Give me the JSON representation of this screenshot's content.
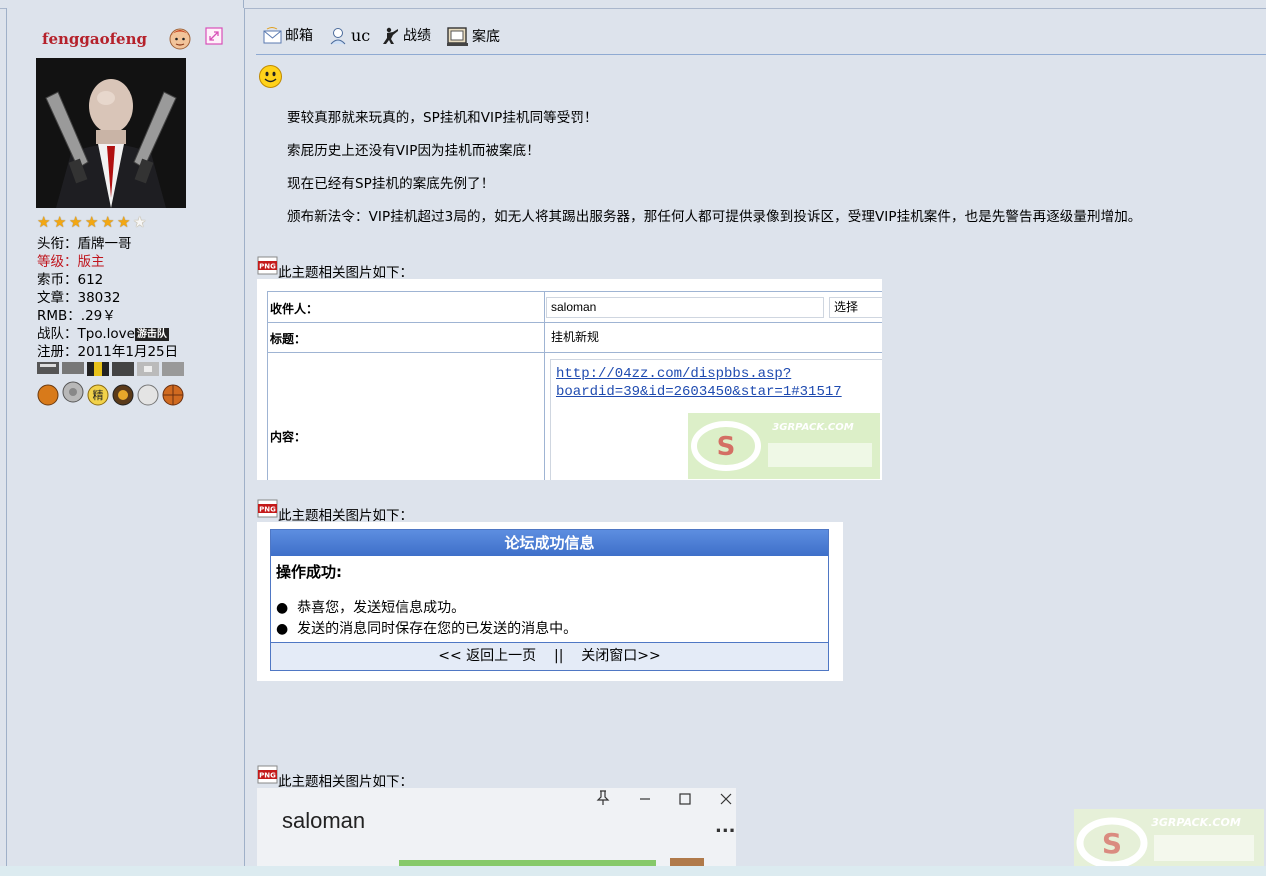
{
  "user": {
    "name": "fenggaofeng",
    "stars_filled": 6,
    "stars_total": 7,
    "title_label": "头衔：",
    "title_value": "盾牌一哥",
    "level_label": "等级：",
    "level_value": "版主",
    "coins_label": "索币：",
    "coins_value": "612",
    "posts_label": "文章：",
    "posts_value": "38032",
    "rmb_label": "RMB：",
    "rmb_value": ".29￥",
    "team_label": "战队：",
    "team_value": "Tpo.love",
    "team_badge": "游击队",
    "reg_label": "注册：",
    "reg_value": "2011年1月25日"
  },
  "toolbar": {
    "mail": "邮箱",
    "uc": "uc",
    "record": "战绩",
    "case": "案底"
  },
  "post": {
    "paragraphs": [
      "要较真那就来玩真的，SP挂机和VIP挂机同等受罚！",
      "索屁历史上还没有VIP因为挂机而被案底！",
      "现在已经有SP挂机的案底先例了！",
      "颁布新法令：VIP挂机超过3局的，如无人将其踢出服务器，那任何人都可提供录像到投诉区，受理VIP挂机案件，也是先警告再逐级量刑增加。"
    ],
    "image_caption": "此主题相关图片如下："
  },
  "image1": {
    "recipient_label": "收件人：",
    "recipient_value": "saloman",
    "select_button": "选择",
    "subject_label": "标题：",
    "subject_value": "挂机新规",
    "content_label": "内容：",
    "link_line1": "http://04zz.com/dispbbs.asp?",
    "link_line2": "boardid=39&id=2603450&star=1#31517",
    "watermark_text": "3GRPACK.COM"
  },
  "image2": {
    "title": "论坛成功信息",
    "heading": "操作成功:",
    "items": [
      "恭喜您，发送短信息成功。",
      "发送的消息同时保存在您的已发送的消息中。"
    ],
    "back": "<< 返回上一页",
    "separator": "||",
    "close": "关闭窗口>>"
  },
  "image3": {
    "name": "saloman",
    "more": "..."
  },
  "watermark": {
    "site": "3GRPACK.COM"
  }
}
